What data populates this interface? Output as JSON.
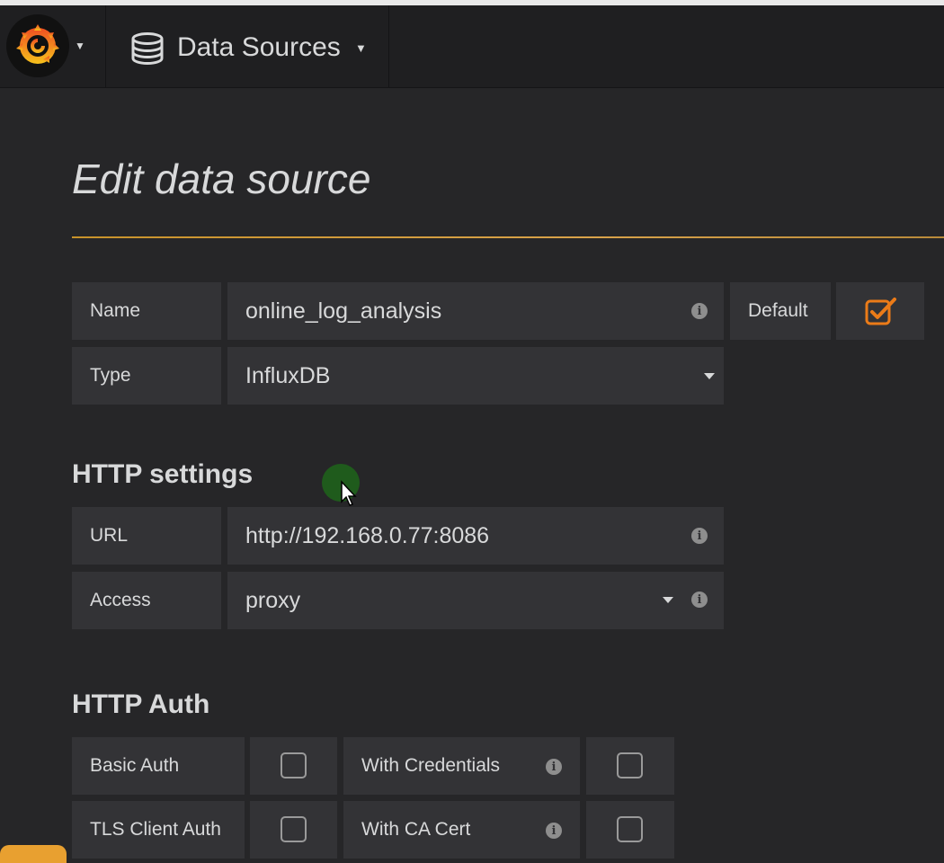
{
  "navbar": {
    "logo_icon": "grafana-logo-icon",
    "dashboard_menu_label": "Data Sources",
    "dashboard_menu_icon": "database-icon"
  },
  "page": {
    "title": "Edit data source"
  },
  "form": {
    "name_label": "Name",
    "name_value": "online_log_analysis",
    "default_label": "Default",
    "default_checked": true,
    "type_label": "Type",
    "type_value": "InfluxDB"
  },
  "http_settings": {
    "title": "HTTP settings",
    "url_label": "URL",
    "url_value": "http://192.168.0.77:8086",
    "access_label": "Access",
    "access_value": "proxy"
  },
  "http_auth": {
    "title": "HTTP Auth",
    "basic_auth_label": "Basic Auth",
    "basic_auth_checked": false,
    "with_credentials_label": "With Credentials",
    "with_credentials_checked": false,
    "tls_client_auth_label": "TLS Client Auth",
    "tls_client_auth_checked": false,
    "with_ca_cert_label": "With CA Cert",
    "with_ca_cert_checked": false
  },
  "colors": {
    "accent": "#eb7b18",
    "background": "#262628",
    "navbar": "#1f1f21",
    "field": "#333336",
    "title_rule": "#c8922a"
  }
}
